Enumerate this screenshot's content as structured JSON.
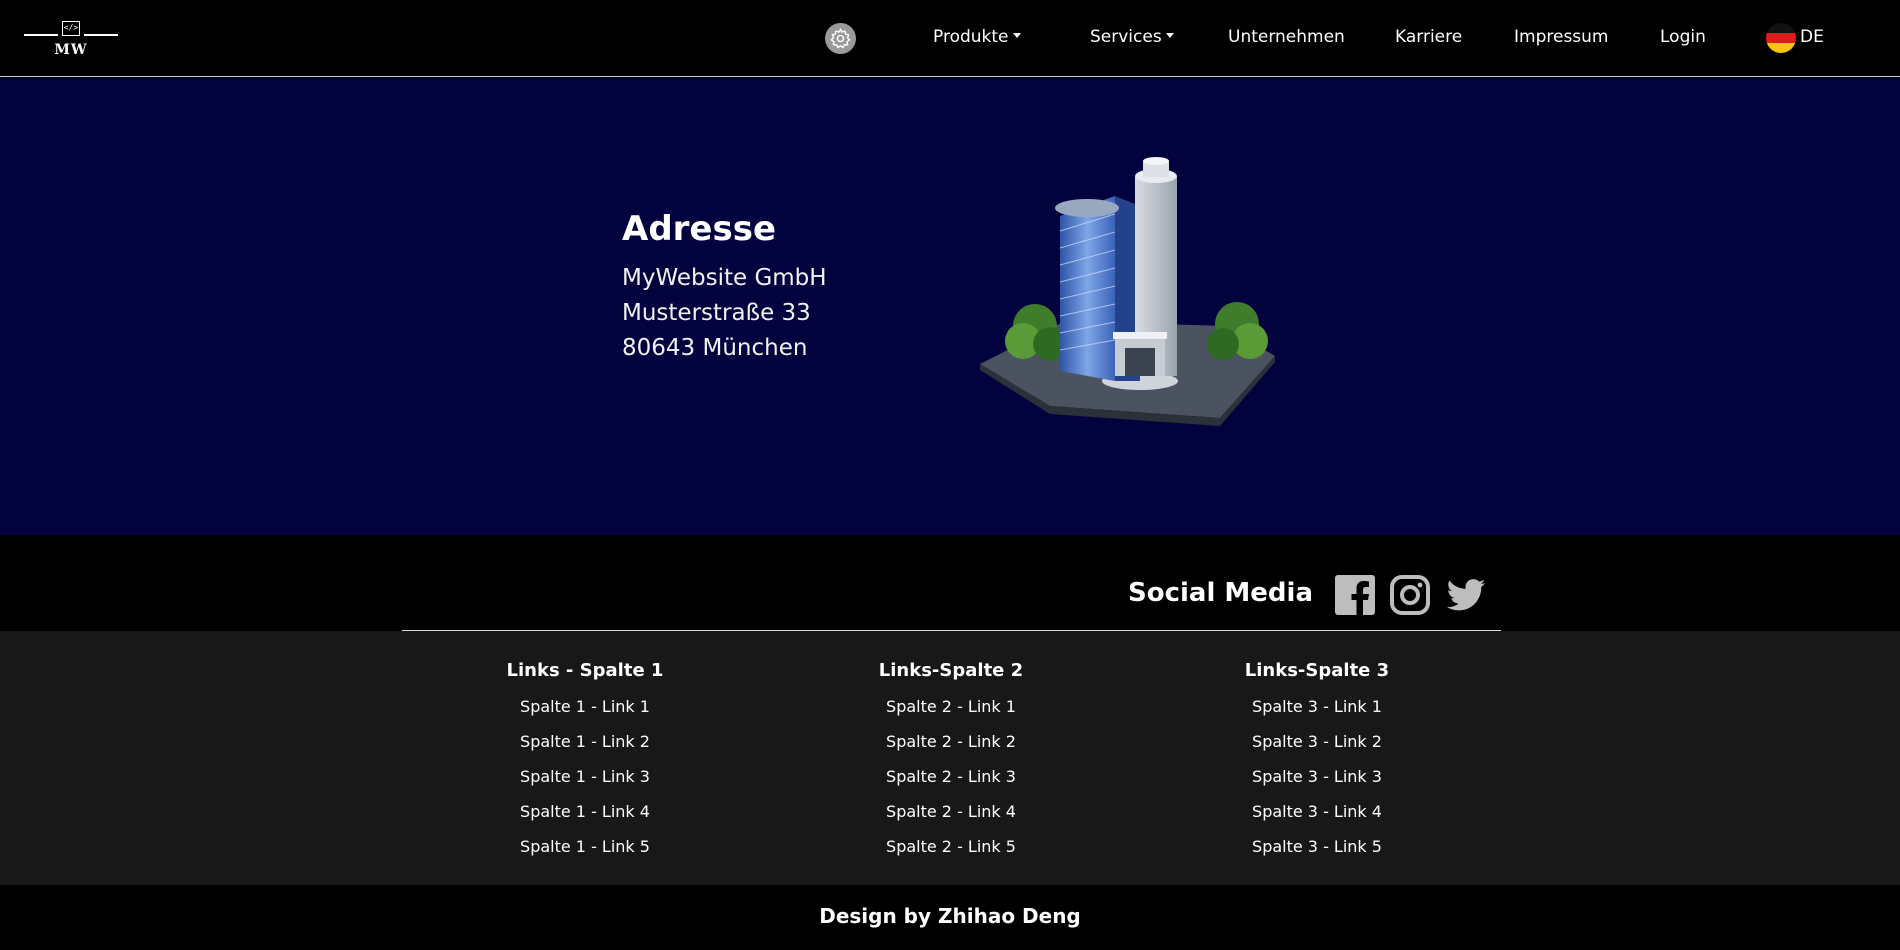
{
  "header": {
    "logo_text": "MW",
    "logo_code_glyph": "</>",
    "settings_icon": "gear-icon",
    "nav": [
      {
        "label": "Produkte",
        "dropdown": true
      },
      {
        "label": "Services",
        "dropdown": true
      },
      {
        "label": "Unternehmen",
        "dropdown": false
      },
      {
        "label": "Karriere",
        "dropdown": false
      },
      {
        "label": "Impressum",
        "dropdown": false
      },
      {
        "label": "Login",
        "dropdown": false
      }
    ],
    "language": {
      "code": "DE",
      "flag_icon": "germany-flag-icon"
    }
  },
  "hero": {
    "title": "Adresse",
    "lines": [
      "MyWebsite GmbH",
      "Musterstraße 33",
      "80643 München"
    ],
    "image_icon": "office-building-illustration"
  },
  "social": {
    "title": "Social Media",
    "icons": [
      "facebook-icon",
      "instagram-icon",
      "twitter-icon"
    ]
  },
  "footer": {
    "columns": [
      {
        "title": "Links - Spalte 1",
        "links": [
          "Spalte 1 - Link 1",
          "Spalte 1 - Link 2",
          "Spalte 1 - Link 3",
          "Spalte 1 - Link 4",
          "Spalte 1 - Link 5"
        ]
      },
      {
        "title": "Links-Spalte 2",
        "links": [
          "Spalte 2 - Link 1",
          "Spalte 2 - Link 2",
          "Spalte 2 - Link 3",
          "Spalte 2 - Link 4",
          "Spalte 2 - Link 5"
        ]
      },
      {
        "title": "Links-Spalte 3",
        "links": [
          "Spalte 3 - Link 1",
          "Spalte 3 - Link 2",
          "Spalte 3 - Link 3",
          "Spalte 3 - Link 4",
          "Spalte 3 - Link 5"
        ]
      }
    ],
    "credit": "Design by Zhihao Deng"
  },
  "colors": {
    "hero_bg": "#02023f",
    "footer_bg": "#181818",
    "page_bg": "#000000"
  }
}
